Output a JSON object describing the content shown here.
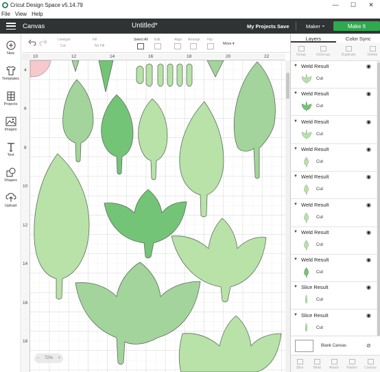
{
  "window": {
    "title": "Cricut Design Space  v5.14.79",
    "controls": [
      "—",
      "☐",
      "✕"
    ]
  },
  "menu": {
    "items": [
      "File",
      "View",
      "Help"
    ]
  },
  "header": {
    "section": "Canvas",
    "doc_title": "Untitled*",
    "my_projects": "My Projects",
    "save": "Save",
    "machine": "Maker",
    "make_it": "Make It",
    "accent": "#2fa84f"
  },
  "sidebar": {
    "items": [
      {
        "label": "New",
        "icon": "plus-circle-icon"
      },
      {
        "label": "Templates",
        "icon": "shirt-icon"
      },
      {
        "label": "Projects",
        "icon": "grid-icon"
      },
      {
        "label": "Images",
        "icon": "image-icon"
      },
      {
        "label": "Text",
        "icon": "text-icon"
      },
      {
        "label": "Shapes",
        "icon": "shapes-icon"
      },
      {
        "label": "Upload",
        "icon": "upload-icon"
      }
    ]
  },
  "toolbar": {
    "linetype_label": "Linetype",
    "linetype_value": "Cut",
    "fill_label": "Fill",
    "fill_value": "No Fill",
    "select_all": "Select All",
    "edit": "Edit",
    "align": "Align",
    "arrange": "Arrange",
    "flip": "Flip",
    "more": "More ▾"
  },
  "ruler": {
    "top": [
      "10",
      "12",
      "14",
      "16",
      "18",
      "20",
      "22"
    ],
    "left": [
      "4",
      "6",
      "8",
      "10",
      "12",
      "14",
      "16",
      "18"
    ]
  },
  "canvas": {
    "zoom_minus": "−",
    "zoom_value": "72%",
    "zoom_plus": "+"
  },
  "panel": {
    "tabs": [
      "Layers",
      "Color Sync"
    ],
    "actions_top": [
      "Group",
      "UnGroup",
      "Duplicate",
      "Delete"
    ],
    "layers": [
      {
        "title": "Weld Result",
        "sub": "Cut",
        "thumb": "tulip"
      },
      {
        "title": "Weld Result",
        "sub": "Cut",
        "thumb": "tulip-dark"
      },
      {
        "title": "Weld Result",
        "sub": "Cut",
        "thumb": "tulip"
      },
      {
        "title": "Weld Result",
        "sub": "Cut",
        "thumb": "leaf"
      },
      {
        "title": "Weld Result",
        "sub": "Cut",
        "thumb": "leaf"
      },
      {
        "title": "Weld Result",
        "sub": "Cut",
        "thumb": "leaf"
      },
      {
        "title": "Weld Result",
        "sub": "Cut",
        "thumb": "leaf"
      },
      {
        "title": "Weld Result",
        "sub": "Cut",
        "thumb": "leaf-dark"
      },
      {
        "title": "Slice Result",
        "sub": "Cut",
        "thumb": "blade"
      },
      {
        "title": "Slice Result",
        "sub": "Cut",
        "thumb": "blade"
      }
    ],
    "blank_canvas": "Blank Canvas",
    "actions_bottom": [
      "Slice",
      "Weld",
      "Attach",
      "Flatten",
      "Contour"
    ]
  },
  "colors": {
    "leaf_light": "#b8e2a8",
    "leaf_mid": "#a3d49b",
    "leaf_dark": "#74c477",
    "header_bg": "#303334"
  }
}
